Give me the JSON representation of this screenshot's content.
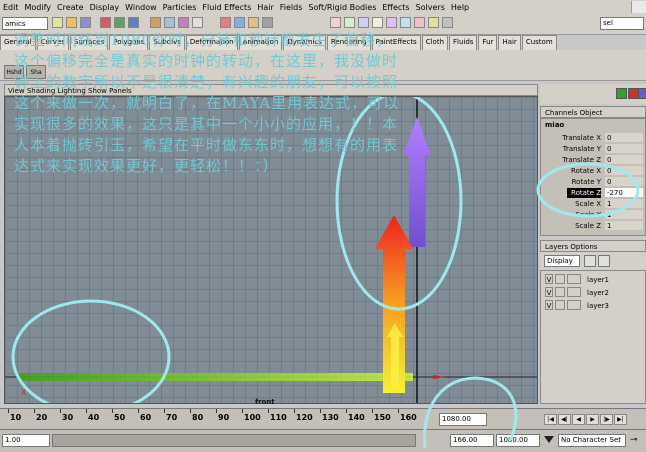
{
  "menu": [
    "Edit",
    "Modify",
    "Create",
    "Display",
    "Window",
    "Particles",
    "Fluid Effects",
    "Hair",
    "Fields",
    "Soft/Rigid Bodies",
    "Effects",
    "Solvers",
    "Help"
  ],
  "status": {
    "mode": "amics",
    "sel_field": "sel"
  },
  "shelf_tabs": [
    "General",
    "Curves",
    "Surfaces",
    "Polygons",
    "Subdivs",
    "Deformation",
    "Animation",
    "Dynamics",
    "Rendering",
    "PaintEffects",
    "Cloth",
    "Fluids",
    "Fur",
    "Hair",
    "Custom"
  ],
  "shelf_buttons": [
    "Hshd",
    "Sha"
  ],
  "viewport": {
    "menu": "View Shading Lighting Show Panels",
    "camera_label": "front",
    "axis_x": "X"
  },
  "overlay_text": "调整时间线到1080你时，分针和秒针都发生了偏移，这个偏移完全是真实的时钟的转动，在这里，我没做时钟上的数字所以不是很清楚，有兴趣的朋友，可以按照这个来做一次，就明白了，在MAYA里用表达式，可以实现很多的效果，这只是其中一个小小的应用，！！本人本着抛砖引玉，希望在平时做东东时，想想有的用表达式来实现效果更好，更轻松！！：）",
  "channel_box": {
    "tabs": "Channels  Object",
    "object": "miao",
    "channels": [
      {
        "name": "Translate X",
        "value": "0"
      },
      {
        "name": "Translate Y",
        "value": "0"
      },
      {
        "name": "Translate Z",
        "value": "0"
      },
      {
        "name": "Rotate X",
        "value": "0"
      },
      {
        "name": "Rotate Y",
        "value": "0"
      },
      {
        "name": "Rotate Z",
        "value": "-270"
      },
      {
        "name": "Scale X",
        "value": "1"
      },
      {
        "name": "Scale Y",
        "value": "1"
      },
      {
        "name": "Scale Z",
        "value": "1"
      }
    ]
  },
  "layers": {
    "header": "Layers  Options",
    "display": "Display",
    "items": [
      {
        "visible": "V",
        "name": "layer1"
      },
      {
        "visible": "V",
        "name": "layer2"
      },
      {
        "visible": "V",
        "name": "layer3"
      }
    ]
  },
  "timeline": {
    "ticks": [
      "10",
      "20",
      "30",
      "40",
      "50",
      "60",
      "70",
      "80",
      "90",
      "100",
      "110",
      "120",
      "130",
      "140",
      "150",
      "160"
    ],
    "current_frame": "1080.00"
  },
  "range": {
    "start": "1.00",
    "end": "166.00",
    "playback_end": "1080.00",
    "character_set": "No Character Set"
  },
  "colors": {
    "overlay_text": "#70c8d4",
    "annotation_circles": "#9ee8f0",
    "arrow_purple": "#a070f0",
    "arrow_red": "#f02020",
    "arrow_yellow": "#f8e020"
  }
}
